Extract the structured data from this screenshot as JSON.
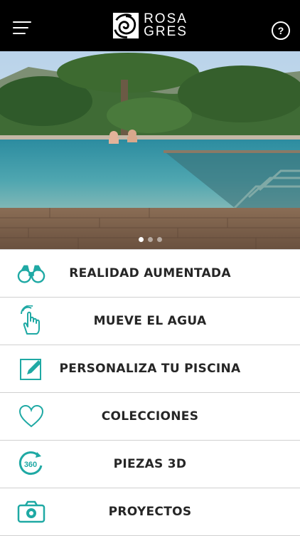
{
  "app": {
    "logo_line1": "ROSA",
    "logo_line2": "GRES",
    "help_label": "?"
  },
  "carousel": {
    "slides": 3,
    "active_index": 0
  },
  "menu": [
    {
      "label": "REALIDAD AUMENTADA",
      "icon": "binoculars-icon"
    },
    {
      "label": "MUEVE EL AGUA",
      "icon": "touch-hand-icon"
    },
    {
      "label": "PERSONALIZA TU PISCINA",
      "icon": "edit-pencil-icon"
    },
    {
      "label": "COLECCIONES",
      "icon": "heart-icon"
    },
    {
      "label": "PIEZAS 3D",
      "icon": "rotate-360-icon"
    },
    {
      "label": "PROYECTOS",
      "icon": "camera-icon"
    }
  ],
  "colors": {
    "accent": "#1fa9a4",
    "header_bg": "#000000",
    "text": "#262626"
  }
}
